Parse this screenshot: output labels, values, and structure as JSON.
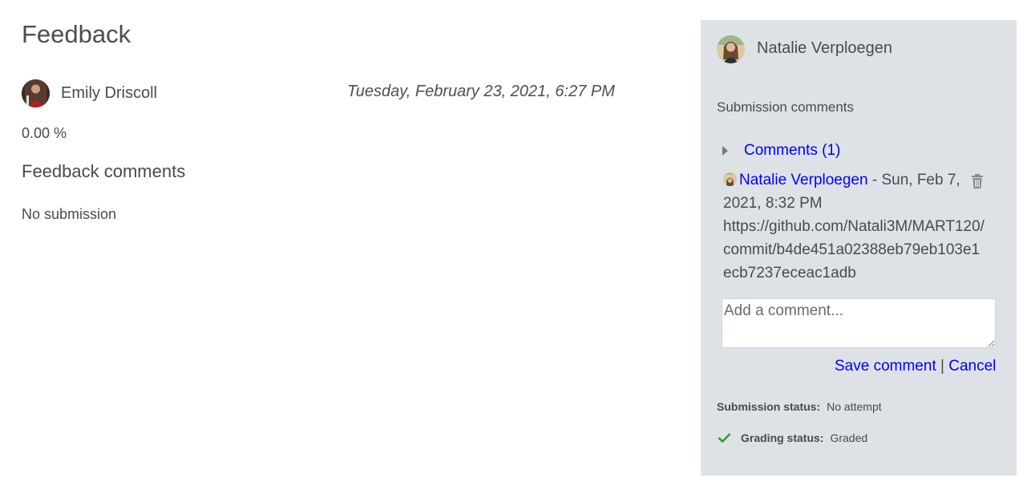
{
  "feedback": {
    "title": "Feedback",
    "grader_name": "Emily Driscoll",
    "date": "Tuesday, February 23, 2021, 6:27 PM",
    "grade": "0.00 %",
    "comments_heading": "Feedback comments",
    "comments_text": "No submission"
  },
  "panel": {
    "student_name": "Natalie Verploegen",
    "submission_comments_label": "Submission comments",
    "comments_toggle_label": "Comments (1)",
    "comment": {
      "author": "Natalie Verploegen",
      "meta": " - Sun, Feb 7, 2021, 8:32 PM",
      "body": "https://github.com/Natali3M/MART120/commit/b4de451a02388eb79eb103e1ecb7237eceac1adb"
    },
    "input_placeholder": "Add a comment...",
    "save_label": "Save comment",
    "separator": " | ",
    "cancel_label": "Cancel",
    "submission_status_label": "Submission status:",
    "submission_status_value": "No attempt",
    "grading_status_label": "Grading status:",
    "grading_status_value": "Graded"
  },
  "colors": {
    "panel_bg": "#dee2e6",
    "link": "#0000ee",
    "check_green": "#2e9e3a"
  },
  "icons": {
    "toggle": "caret-right-icon",
    "delete": "trash-icon",
    "status": "check-icon"
  }
}
